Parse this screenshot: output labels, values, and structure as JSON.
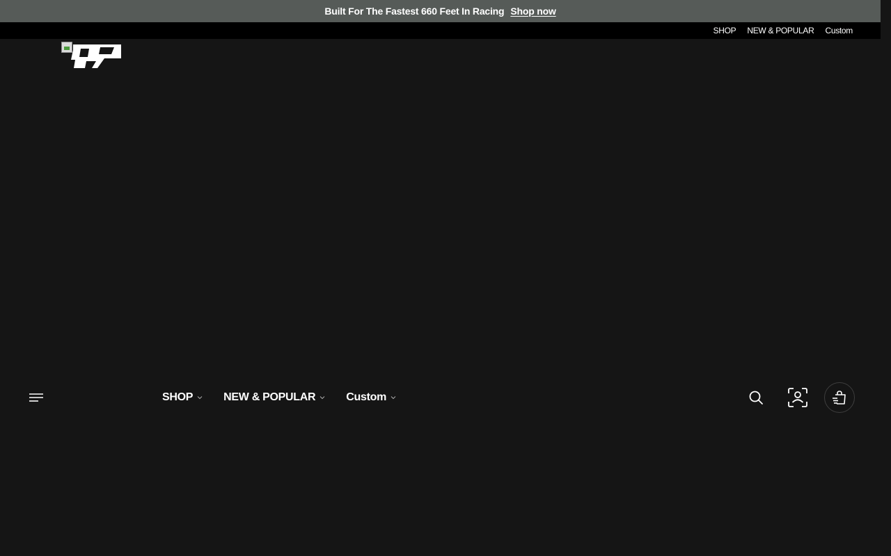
{
  "announcement": {
    "text": "Built For The Fastest 660 Feet In Racing",
    "link_label": "Shop now"
  },
  "top_nav": {
    "items": [
      {
        "label": "SHOP"
      },
      {
        "label": "NEW & POPULAR"
      },
      {
        "label": "Custom"
      }
    ]
  },
  "header": {
    "logo_icon": "broken-image-icon",
    "menu_icon": "hamburger-menu-icon",
    "nav_items": [
      {
        "label": "SHOP",
        "icon": "chevron-down-icon"
      },
      {
        "label": "NEW & POPULAR",
        "icon": "chevron-down-icon"
      },
      {
        "label": "Custom",
        "icon": "chevron-down-icon"
      }
    ],
    "actions": {
      "search_icon": "search-icon",
      "account_icon": "account-icon",
      "cart_icon": "shopping-bag-icon"
    }
  },
  "colors": {
    "announcement_bg": "#565b58",
    "top_nav_bg": "#000000",
    "page_bg": "#151515",
    "text": "#ffffff"
  }
}
